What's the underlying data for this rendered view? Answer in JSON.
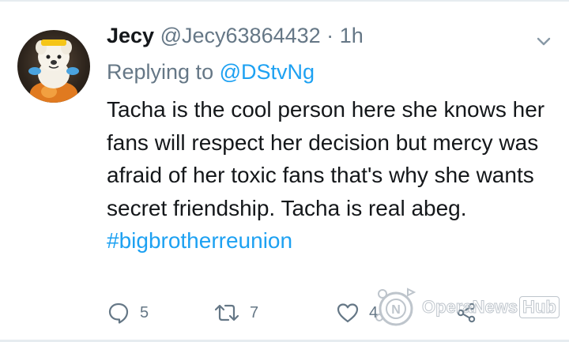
{
  "tweet": {
    "author_name": "Jecy",
    "author_handle": "@Jecy63864432",
    "separator": "·",
    "time": "1h",
    "replying_prefix": "Replying to",
    "replying_to": "@DStvNg",
    "text": "Tacha is the cool person here she knows her fans will respect her decision but mercy was afraid of her toxic fans that's why she wants secret friendship.  Tacha is real abeg.",
    "hashtag": "#bigbrotherreunion"
  },
  "actions": {
    "reply_count": "5",
    "retweet_count": "7",
    "like_count": "4"
  },
  "watermark": {
    "part1": "Opera",
    "part2": "News",
    "part3": "Hub"
  },
  "icons": {
    "reply": "comment-icon",
    "retweet": "retweet-icon",
    "like": "heart-icon",
    "share": "share-icon",
    "menu": "chevron-down-icon"
  },
  "colors": {
    "link": "#1da1f2",
    "secondary_text": "#657786",
    "primary_text": "#14171a",
    "background": "#ffffff"
  }
}
